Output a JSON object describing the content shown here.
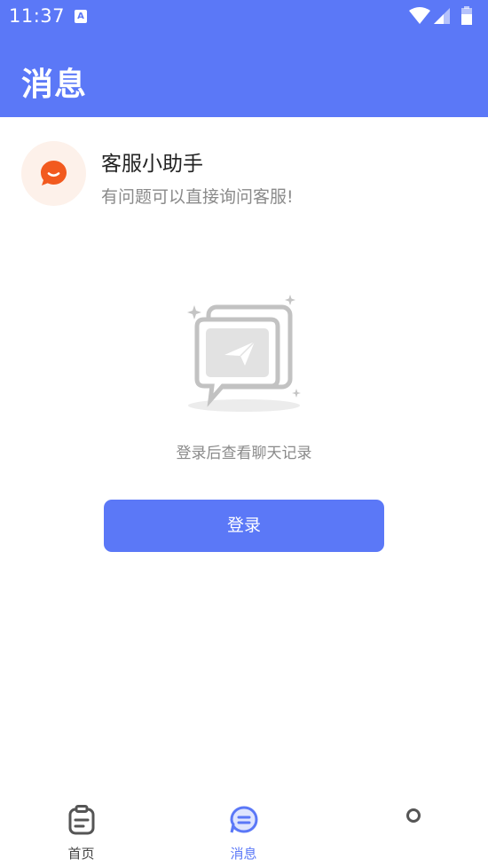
{
  "status_bar": {
    "time": "11:37",
    "notification_glyph": "A",
    "icons": [
      "wifi-icon",
      "signal-icon",
      "battery-icon"
    ]
  },
  "app_bar": {
    "title": "消息"
  },
  "customer_service": {
    "name": "客服小助手",
    "description": "有问题可以直接询问客服!",
    "icon": "chat-bubble-icon",
    "accent_color": "#f25a1f"
  },
  "empty_state": {
    "icon": "message-plane-illustration",
    "text": "登录后查看聊天记录",
    "button_label": "登录"
  },
  "bottom_nav": {
    "items": [
      {
        "label": "首页",
        "icon": "clipboard-icon",
        "active": false
      },
      {
        "label": "消息",
        "icon": "message-icon",
        "active": true
      },
      {
        "label": "",
        "icon": "profile-icon",
        "active": false
      }
    ]
  },
  "colors": {
    "primary": "#5b78f7",
    "text_primary": "#222222",
    "text_secondary": "#8a8a8a"
  }
}
